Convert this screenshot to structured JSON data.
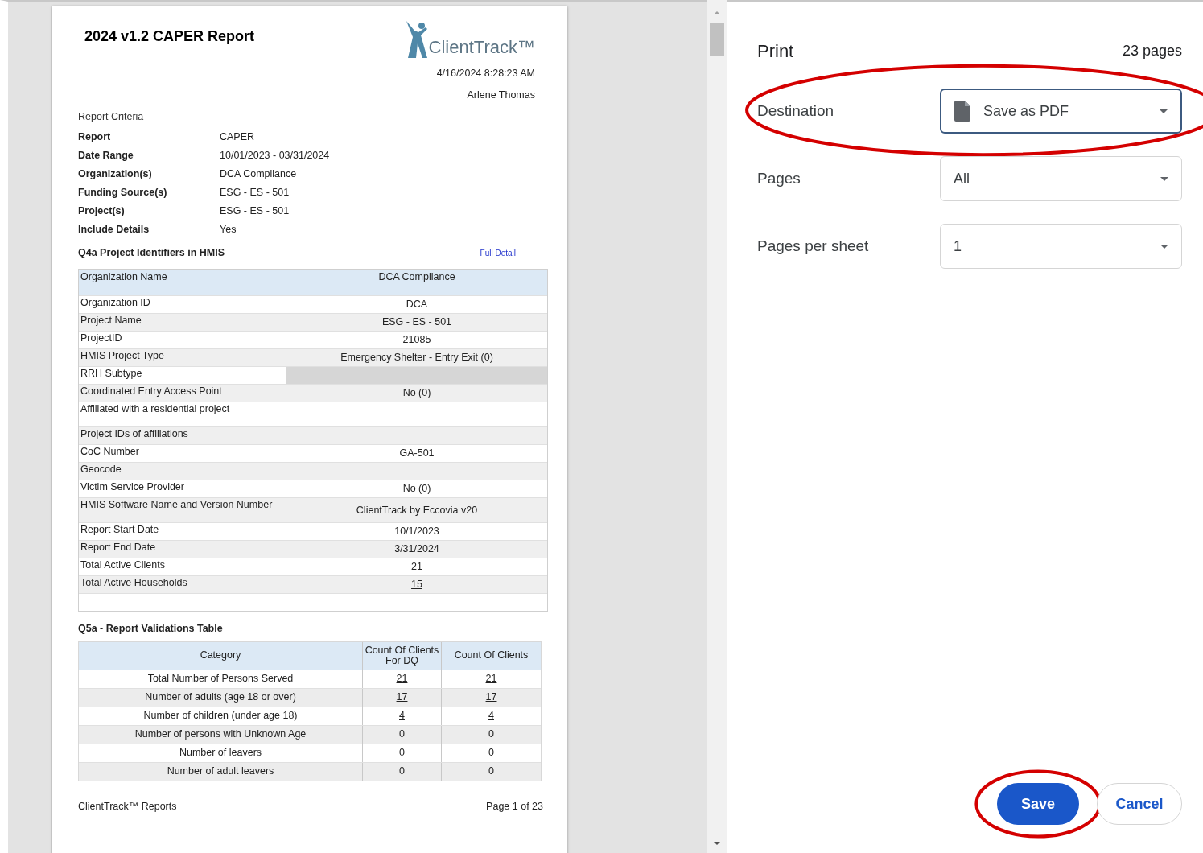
{
  "report": {
    "title": "2024 v1.2 CAPER Report",
    "logo_text": "ClientTrack™",
    "timestamp": "4/16/2024 8:28:23 AM",
    "author": "Arlene Thomas",
    "criteria_heading": "Report Criteria",
    "criteria": [
      {
        "label": "Report",
        "value": "CAPER"
      },
      {
        "label": "Date Range",
        "value": "10/01/2023 - 03/31/2024"
      },
      {
        "label": "Organization(s)",
        "value": "DCA Compliance"
      },
      {
        "label": "Funding Source(s)",
        "value": "ESG - ES - 501"
      },
      {
        "label": "Project(s)",
        "value": "ESG - ES - 501"
      },
      {
        "label": "Include Details",
        "value": "Yes"
      }
    ],
    "identifiers": {
      "title": "Q4a Project Identifiers in HMIS",
      "link": "Full Detail",
      "header": [
        "Organization Name",
        "DCA Compliance"
      ],
      "rows": [
        {
          "label": "Organization ID",
          "value": "DCA",
          "link": false,
          "disabled": false
        },
        {
          "label": "Project Name",
          "value": "ESG - ES - 501",
          "link": false,
          "disabled": false
        },
        {
          "label": "ProjectID",
          "value": "21085",
          "link": false,
          "disabled": false
        },
        {
          "label": "HMIS Project Type",
          "value": "Emergency Shelter - Entry Exit (0)",
          "link": false,
          "disabled": false
        },
        {
          "label": "RRH Subtype",
          "disabled": true
        },
        {
          "label": "Coordinated Entry Access Point",
          "value": "No (0)",
          "link": false,
          "disabled": false
        },
        {
          "label": "Affiliated with a residential project",
          "disabled": false
        },
        {
          "label": "Project IDs of affiliations",
          "disabled": false
        },
        {
          "label": "CoC Number",
          "value": "GA-501",
          "link": false,
          "disabled": false
        },
        {
          "label": "Geocode",
          "disabled": false
        },
        {
          "label": "Victim Service Provider",
          "value": "No (0)",
          "link": false,
          "disabled": false
        },
        {
          "label": "HMIS Software Name and Version Number",
          "value": "ClientTrack by Eccovia v20",
          "link": false,
          "disabled": false
        },
        {
          "label": "Report Start Date",
          "value": "10/1/2023",
          "link": false,
          "disabled": false
        },
        {
          "label": "Report End Date",
          "value": "3/31/2024",
          "link": false,
          "disabled": false
        },
        {
          "label": "Total Active Clients",
          "value": "21",
          "link": true,
          "disabled": false
        },
        {
          "label": "Total Active Households",
          "value": "15",
          "link": true,
          "disabled": false
        }
      ]
    },
    "validations": {
      "title": "Q5a - Report Validations Table",
      "columns": [
        "Category",
        "Count Of Clients For DQ",
        "Count Of Clients"
      ],
      "rows": [
        {
          "category": "Total Number of Persons Served",
          "dq": "21",
          "clients": "21",
          "link": true
        },
        {
          "category": "Number of adults (age 18 or over)",
          "dq": "17",
          "clients": "17",
          "link": true
        },
        {
          "category": "Number of children (under age 18)",
          "dq": "4",
          "clients": "4",
          "link": true
        },
        {
          "category": "Number of persons with Unknown Age",
          "dq": "0",
          "clients": "0",
          "link": false
        },
        {
          "category": "Number of leavers",
          "dq": "0",
          "clients": "0",
          "link": false
        },
        {
          "category": "Number of adult leavers",
          "dq": "0",
          "clients": "0",
          "link": false
        }
      ]
    },
    "footer": {
      "left": "ClientTrack™ Reports",
      "right": "Page 1 of 23"
    }
  },
  "print": {
    "title": "Print",
    "page_count": "23 pages",
    "settings": [
      {
        "label": "Destination",
        "value": "Save as PDF",
        "kind": "file",
        "focused": true,
        "highlighted": true
      },
      {
        "label": "Pages",
        "value": "All",
        "kind": "plain",
        "focused": false,
        "highlighted": false
      },
      {
        "label": "Pages per sheet",
        "value": "1",
        "kind": "plain",
        "focused": false,
        "highlighted": false
      }
    ],
    "buttons": [
      {
        "label": "Save",
        "kind": "primary",
        "highlighted": true
      },
      {
        "label": "Cancel",
        "kind": "secondary",
        "highlighted": false
      }
    ]
  }
}
